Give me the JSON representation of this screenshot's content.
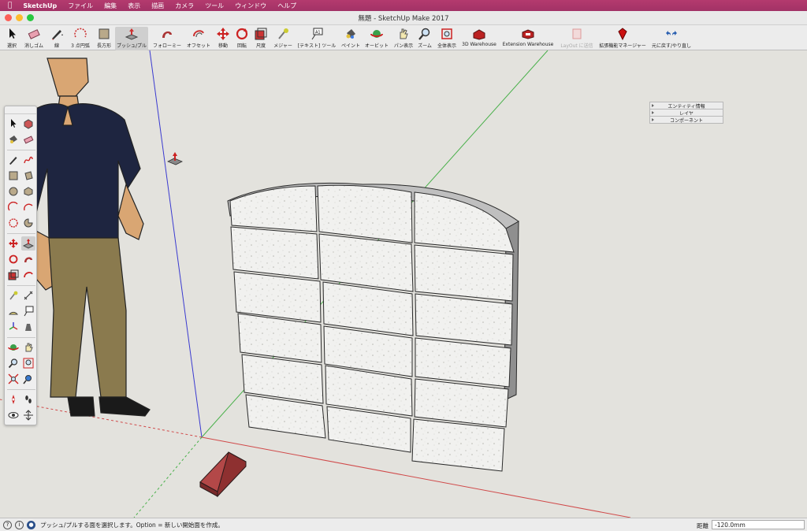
{
  "menubar": {
    "app_name": "SketchUp",
    "items": [
      "ファイル",
      "編集",
      "表示",
      "描画",
      "カメラ",
      "ツール",
      "ウィンドウ",
      "ヘルプ"
    ]
  },
  "window": {
    "title": "無題 - SketchUp Make 2017"
  },
  "toolbar": {
    "items": [
      {
        "id": "select",
        "label": "選択",
        "icon": "arrow-icon"
      },
      {
        "id": "eraser",
        "label": "消しゴム",
        "icon": "eraser-icon"
      },
      {
        "id": "line",
        "label": "線",
        "icon": "pencil-icon"
      },
      {
        "id": "arc",
        "label": "3 点円弧",
        "icon": "arc-icon"
      },
      {
        "id": "rectangle",
        "label": "長方形",
        "icon": "rectangle-icon"
      },
      {
        "id": "pushpull",
        "label": "プッシュ/プル",
        "icon": "pushpull-icon",
        "active": true
      },
      {
        "id": "followme",
        "label": "フォローミー",
        "icon": "followme-icon"
      },
      {
        "id": "offset",
        "label": "オフセット",
        "icon": "offset-icon"
      },
      {
        "id": "move",
        "label": "移動",
        "icon": "move-icon"
      },
      {
        "id": "rotate",
        "label": "回転",
        "icon": "rotate-icon"
      },
      {
        "id": "scale",
        "label": "尺度",
        "icon": "scale-icon"
      },
      {
        "id": "tape",
        "label": "メジャー",
        "icon": "tape-measure-icon"
      },
      {
        "id": "text",
        "label": "[テキスト] ツール",
        "icon": "text-icon"
      },
      {
        "id": "paint",
        "label": "ペイント",
        "icon": "paint-bucket-icon"
      },
      {
        "id": "orbit",
        "label": "オービット",
        "icon": "orbit-icon"
      },
      {
        "id": "pan",
        "label": "パン表示",
        "icon": "pan-hand-icon"
      },
      {
        "id": "zoom",
        "label": "ズーム",
        "icon": "zoom-icon"
      },
      {
        "id": "zoomext",
        "label": "全体表示",
        "icon": "zoom-extents-icon"
      },
      {
        "id": "warehouse",
        "label": "3D Warehouse",
        "icon": "warehouse-icon"
      },
      {
        "id": "extwarehouse",
        "label": "Extension Warehouse",
        "icon": "extension-warehouse-icon"
      },
      {
        "id": "layout",
        "label": "LayOut に送信",
        "icon": "layout-icon",
        "disabled": true
      },
      {
        "id": "extmgr",
        "label": "拡張機能マネージャー",
        "icon": "ruby-icon"
      },
      {
        "id": "undoredo",
        "label": "元に戻す/やり直し",
        "icon": "undo-redo-icon"
      }
    ]
  },
  "tray": {
    "items": [
      "エンティティ情報",
      "レイヤ",
      "コンポーネント"
    ]
  },
  "status": {
    "message": "プッシュ/プルする面を選択します。Option = 新しい開始面を作成。",
    "measure_label": "距離",
    "measure_value": "-120.0mm",
    "icons": [
      "geo-location-icon",
      "credits-icon",
      "user-icon"
    ]
  },
  "colors": {
    "menubar": "#a23266",
    "axis_red": "#d04a4a",
    "axis_green": "#49b04a",
    "axis_blue": "#3a3ad0",
    "brick": "#a84343"
  }
}
